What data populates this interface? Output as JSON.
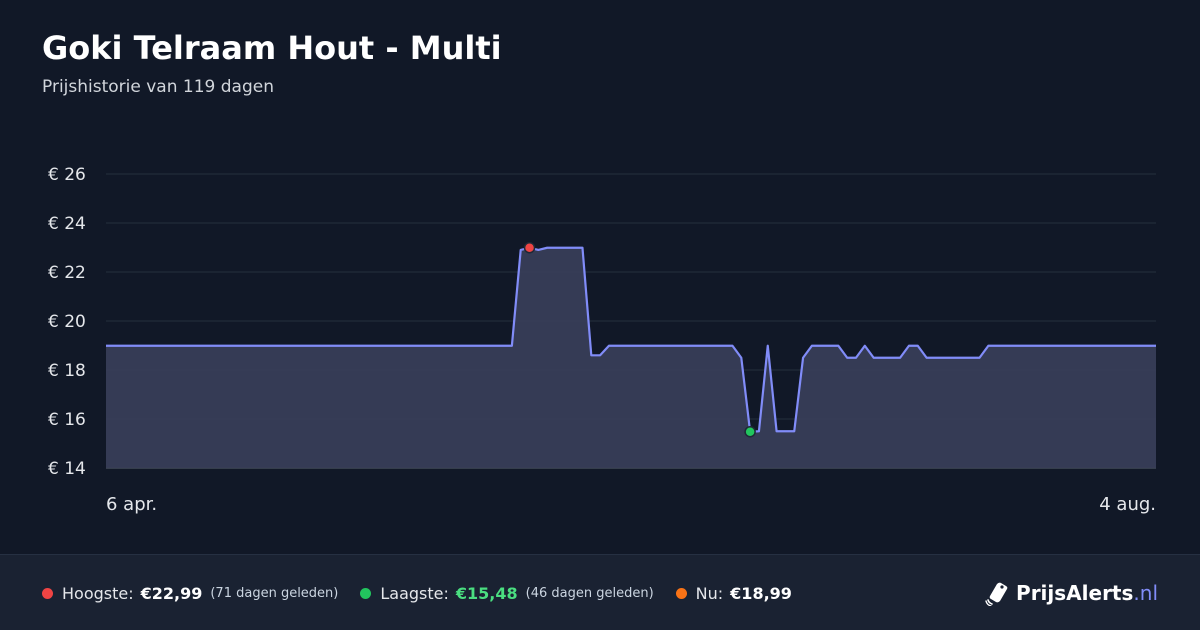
{
  "header": {
    "title": "Goki Telraam Hout - Multi",
    "subtitle": "Prijshistorie van 119 dagen"
  },
  "chart_data": {
    "type": "area",
    "yticks": [
      "€ 26",
      "€ 24",
      "€ 22",
      "€ 20",
      "€ 18",
      "€ 16",
      "€ 14"
    ],
    "ytick_values": [
      26,
      24,
      22,
      20,
      18,
      16,
      14
    ],
    "ylim": [
      14,
      26
    ],
    "x_start_label": "6 apr.",
    "x_end_label": "4 aug.",
    "grid": true,
    "series": [
      {
        "values": [
          18.99,
          18.99,
          18.99,
          18.99,
          18.99,
          18.99,
          18.99,
          18.99,
          18.99,
          18.99,
          18.99,
          18.99,
          18.99,
          18.99,
          18.99,
          18.99,
          18.99,
          18.99,
          18.99,
          18.99,
          18.99,
          18.99,
          18.99,
          18.99,
          18.99,
          18.99,
          18.99,
          18.99,
          18.99,
          18.99,
          18.99,
          18.99,
          18.99,
          18.99,
          18.99,
          18.99,
          18.99,
          18.99,
          18.99,
          18.99,
          18.99,
          18.99,
          18.99,
          18.99,
          18.99,
          18.99,
          18.99,
          22.9,
          22.99,
          22.9,
          22.99,
          22.99,
          22.99,
          22.99,
          22.99,
          18.6,
          18.6,
          18.99,
          18.99,
          18.99,
          18.99,
          18.99,
          18.99,
          18.99,
          18.99,
          18.99,
          18.99,
          18.99,
          18.99,
          18.99,
          18.99,
          18.99,
          18.5,
          15.48,
          15.5,
          18.99,
          15.5,
          15.5,
          15.5,
          18.5,
          18.99,
          18.99,
          18.99,
          18.99,
          18.5,
          18.5,
          18.99,
          18.5,
          18.5,
          18.5,
          18.5,
          18.99,
          18.99,
          18.5,
          18.5,
          18.5,
          18.5,
          18.5,
          18.5,
          18.5,
          18.99,
          18.99,
          18.99,
          18.99,
          18.99,
          18.99,
          18.99,
          18.99,
          18.99,
          18.99,
          18.99,
          18.99,
          18.99,
          18.99,
          18.99,
          18.99,
          18.99,
          18.99,
          18.99,
          18.99
        ]
      }
    ],
    "markers": [
      {
        "kind": "highest",
        "index": 48,
        "value": 22.99,
        "color": "#ef4444"
      },
      {
        "kind": "lowest",
        "index": 73,
        "value": 15.48,
        "color": "#22c55e"
      }
    ]
  },
  "footer": {
    "highest_label": "Hoogste:",
    "highest_value": "€22,99",
    "highest_note": "(71 dagen geleden)",
    "lowest_label": "Laagste:",
    "lowest_value": "€15,48",
    "lowest_note": "(46 dagen geleden)",
    "current_label": "Nu:",
    "current_value": "€18,99",
    "logo_brand": "PrijsAlerts",
    "logo_tld": ".nl"
  },
  "colors": {
    "background": "#111827",
    "line": "#818cf8",
    "area": "#383d57",
    "grid": "#1f2937",
    "highest": "#ef4444",
    "lowest": "#22c55e",
    "current": "#f97316",
    "lowest_value": "#4ade80"
  }
}
